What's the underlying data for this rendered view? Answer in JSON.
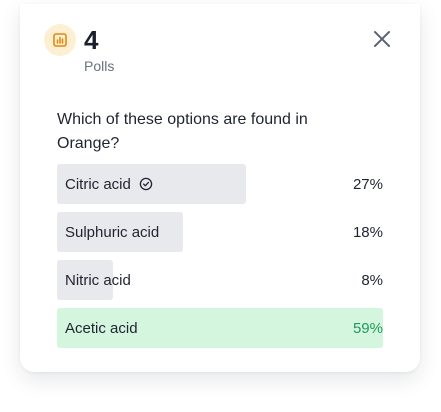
{
  "header": {
    "icon": "poll-chart-icon",
    "count": "4",
    "count_label": "Polls",
    "close_icon": "close-icon"
  },
  "poll": {
    "question": "Which of these options are found in Orange?",
    "options": [
      {
        "label": "Citric acid",
        "percent": "27%",
        "share": 0.27,
        "voted": true,
        "correct": false
      },
      {
        "label": "Sulphuric acid",
        "percent": "18%",
        "share": 0.18,
        "voted": false,
        "correct": false
      },
      {
        "label": "Nitric acid",
        "percent": "8%",
        "share": 0.08,
        "voted": false,
        "correct": false
      },
      {
        "label": "Acetic acid",
        "percent": "59%",
        "share": 0.59,
        "voted": false,
        "correct": true
      }
    ]
  },
  "colors": {
    "icon_bg": "#fdefd2",
    "icon_fg": "#e08a12",
    "bar_default": "#e8e9ed",
    "bar_correct": "#d4f6df",
    "percent_correct": "#1e9a5a"
  }
}
